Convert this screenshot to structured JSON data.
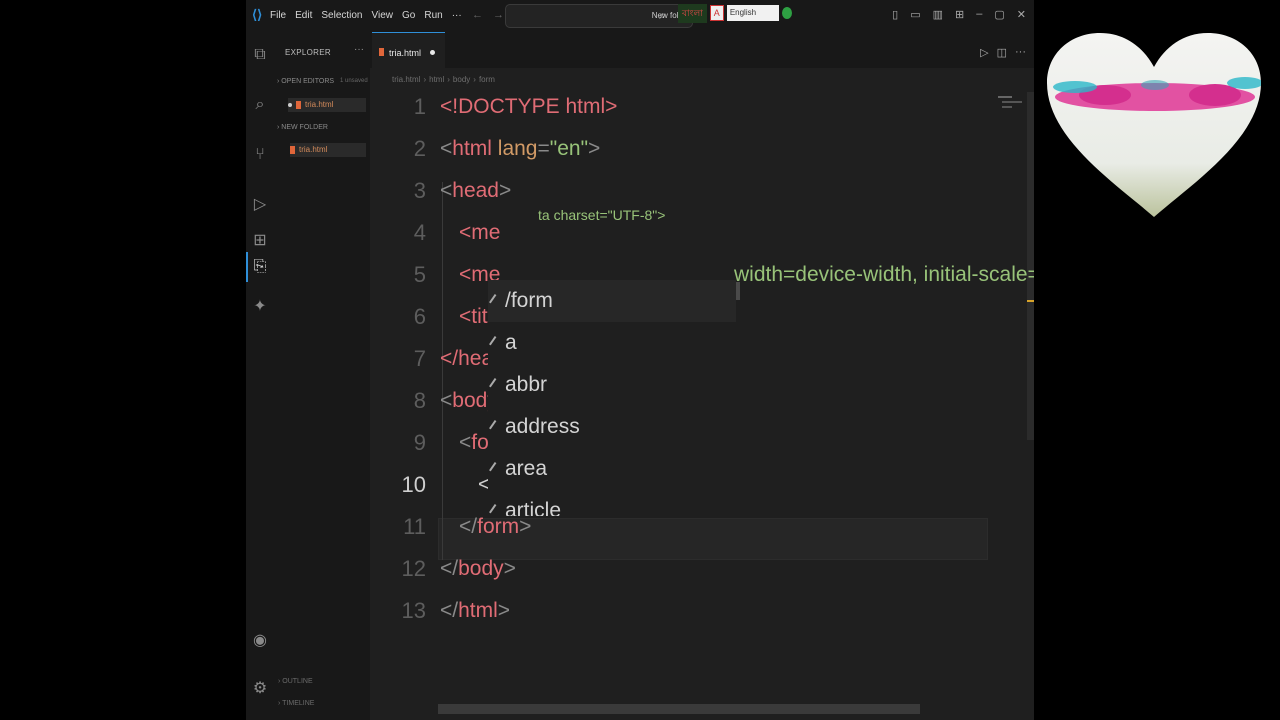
{
  "titlebar": {
    "menu": [
      "File",
      "Edit",
      "Selection",
      "View",
      "Go",
      "Run",
      "···"
    ],
    "search_text": "New folder",
    "ime_script": "বাংলা",
    "ime_language": "English",
    "window_controls": [
      "minimize",
      "restore",
      "close"
    ]
  },
  "sidebar": {
    "header": "EXPLORER",
    "more": "···",
    "open_editors_label": "OPEN EDITORS",
    "open_editors_sub": "1 unsaved",
    "open_editor_file": "tria.html",
    "folder_label": "NEW FOLDER",
    "folder_file": "tria.html",
    "outline_label": "OUTLINE",
    "timeline_label": "TIMELINE"
  },
  "editor": {
    "tab_label": "tria.html",
    "breadcrumb": [
      "tria.html",
      "html",
      "body",
      "form"
    ],
    "line_numbers": [
      "1",
      "2",
      "3",
      "4",
      "5",
      "6",
      "7",
      "8",
      "9",
      "10",
      "11",
      "12",
      "13"
    ],
    "current_line": "10",
    "lines": {
      "l1": "<!DOCTYPE html>",
      "l2_open": "<",
      "l2_tag": "html",
      "l2_attr": " lang",
      "l2_eq": "=",
      "l2_val": "\"en\"",
      "l2_close": ">",
      "l3_open": "<",
      "l3_tag": "head",
      "l3_close": ">",
      "l4": "<me",
      "l4_tail": "ta charset=\"UTF-8\">",
      "l5": "<me",
      "l5_tail": "width=device-width, initial-scale=",
      "l6": "<titl",
      "l7": "</head",
      "l8_open": "<",
      "l8_tag": "body",
      "l9_open": "<",
      "l9_tag": "for",
      "l10": "<",
      "l11_open": "</",
      "l11_tag": "form",
      "l11_close": ">",
      "l12_open": "</",
      "l12_tag": "body",
      "l12_close": ">",
      "l13_open": "</",
      "l13_tag": "html",
      "l13_close": ">"
    },
    "suggestions": [
      "/form",
      "a",
      "abbr",
      "address",
      "area",
      "article"
    ]
  },
  "colors": {
    "tag": "#e06c75",
    "attribute": "#d19a66",
    "string": "#98c379",
    "accent": "#2f8fd8",
    "heart_accent": "#e0409a"
  }
}
